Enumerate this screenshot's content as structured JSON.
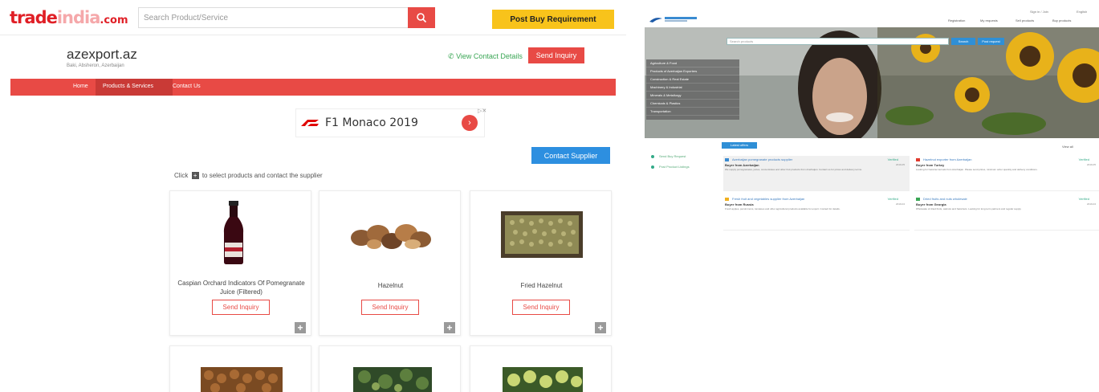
{
  "tradeindia": {
    "logo": {
      "part1": "trade",
      "part2": "india",
      "part3": ".com"
    },
    "search_placeholder": "Search Product/Service",
    "post_buy_label": "Post Buy Requirement",
    "company": {
      "name": "azexport.az",
      "location": "Baki, Absheron, Azerbaijan"
    },
    "view_contact_label": "View Contact Details",
    "send_inquiry_label": "Send Inquiry",
    "nav": [
      "Home",
      "Products & Services",
      "Contact Us"
    ],
    "ad": {
      "text": "F1 Monaco 2019"
    },
    "contact_supplier_label": "Contact Supplier",
    "click_hint": {
      "before": "Click",
      "after": "to select products and contact the supplier"
    },
    "products": [
      {
        "name": "Caspian Orchard Indicators Of Pomegranate Juice (Filtered)",
        "button": "Send Inquiry"
      },
      {
        "name": "Hazelnut",
        "button": "Send Inquiry"
      },
      {
        "name": "Fried Hazelnut",
        "button": "Send Inquiry"
      }
    ]
  },
  "azexport": {
    "top_links": [
      "Registration",
      "My requests",
      "Sell products",
      "Buy products"
    ],
    "account_links": [
      "Sign in / Join",
      "English"
    ],
    "hero_search_placeholder": "Search products",
    "hero_btn1": "Search",
    "hero_btn2": "Post request",
    "hero_menu": [
      "Agriculture & Food",
      "Products of Azerbaijan Exporters",
      "Construction & Real Estate",
      "Machinery & Industrial",
      "Minerals & Metallurgy",
      "Chemicals & Plastics",
      "Transportation"
    ],
    "side_links": [
      "Send Buy Request",
      "Post Product Listings"
    ],
    "tab_label": "Latest offers",
    "right_link": "View all",
    "cards": [
      {
        "title": "Azerbaijan pomegranate products supplier",
        "badge": "Verified",
        "subtitle": "Buyer from Azerbaijan",
        "date": "2019-05",
        "desc": "We supply pomegranates, juices, concentrates and other fruit products from Azerbaijan. Contact us for prices and delivery terms."
      },
      {
        "title": "Hazelnut exporter from Azerbaijan",
        "badge": "Verified",
        "subtitle": "Buyer from Turkey",
        "date": "2019-05",
        "desc": "Looking for hazelnut kernels from Azerbaijan. Please send prices, minimum order quantity and delivery conditions."
      },
      {
        "title": "Fresh fruit and vegetables supplier from Azerbaijan",
        "badge": "Verified",
        "subtitle": "Buyer from Russia",
        "date": "2019-04",
        "desc": "Fresh apples, persimmons, tomatoes and other agricultural products available for export. Contact for details."
      },
      {
        "title": "Dried fruits and nuts wholesale",
        "badge": "Verified",
        "subtitle": "Buyer from Georgia",
        "date": "2019-04",
        "desc": "Wholesale of dried fruits, walnuts and hazelnuts. Looking for long term partners and regular supply."
      }
    ]
  }
}
